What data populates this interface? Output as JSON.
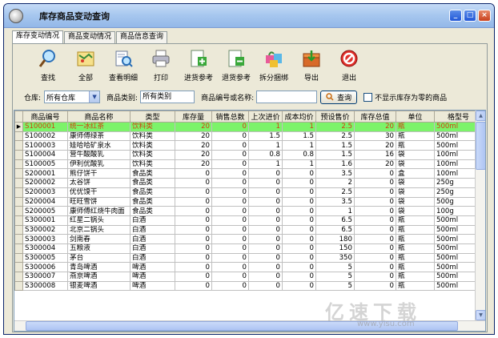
{
  "window": {
    "title": "库存商品变动查询",
    "minimize": "_",
    "maximize": "□",
    "close": "×"
  },
  "tabs": [
    "库存变动情况",
    "商品变动情况",
    "商品信息查询"
  ],
  "toolbar": [
    {
      "label": "查找",
      "icon": "magnifier-icon"
    },
    {
      "label": "全部",
      "icon": "map-icon"
    },
    {
      "label": "查看明细",
      "icon": "detail-search-icon"
    },
    {
      "label": "打印",
      "icon": "printer-icon"
    },
    {
      "label": "进货参考",
      "icon": "document-add-icon"
    },
    {
      "label": "退货参考",
      "icon": "document-remove-icon"
    },
    {
      "label": "拆分捆绑",
      "icon": "package-icon"
    },
    {
      "label": "导出",
      "icon": "export-box-icon"
    },
    {
      "label": "退出",
      "icon": "exit-icon"
    }
  ],
  "filter": {
    "warehouse_label": "仓库:",
    "warehouse_value": "所有仓库",
    "category_label": "商品类别:",
    "category_value": "所有类别",
    "code_label": "商品编号或名称:",
    "code_value": "",
    "query_label": "查询",
    "zero_stock_label": "不显示库存为零的商品"
  },
  "table": {
    "columns": [
      "商品编号",
      "商品名称",
      "类型",
      "库存量",
      "销售总数",
      "上次进价",
      "成本均价",
      "预设售价",
      "库存总值",
      "单位",
      "格型号"
    ],
    "rows": [
      [
        "S100001",
        "统一冰红茶",
        "饮料类",
        "20",
        "0",
        "1",
        "1",
        "2.5",
        "20",
        "瓶",
        "500ml"
      ],
      [
        "S100002",
        "康师傅绿茶",
        "饮料类",
        "20",
        "0",
        "1.5",
        "1.5",
        "2.5",
        "30",
        "瓶",
        "500ml"
      ],
      [
        "S100003",
        "娃哈哈矿泉水",
        "饮料类",
        "20",
        "0",
        "1",
        "1",
        "1.5",
        "20",
        "瓶",
        "500ml"
      ],
      [
        "S100004",
        "营牛酸酸乳",
        "饮料类",
        "20",
        "0",
        "0.8",
        "0.8",
        "1.5",
        "16",
        "袋",
        "100ml"
      ],
      [
        "S100005",
        "伊利优酸乳",
        "饮料类",
        "20",
        "0",
        "1",
        "1",
        "1.6",
        "20",
        "袋",
        "100ml"
      ],
      [
        "S200001",
        "熊仔饼干",
        "食品类",
        "0",
        "0",
        "0",
        "0",
        "3.5",
        "0",
        "盒",
        "100ml"
      ],
      [
        "S200002",
        "太谷饼",
        "食品类",
        "0",
        "0",
        "0",
        "0",
        "2",
        "0",
        "袋",
        "250g"
      ],
      [
        "S200003",
        "优优馍干",
        "食品类",
        "0",
        "0",
        "0",
        "0",
        "2.5",
        "0",
        "袋",
        "250g"
      ],
      [
        "S200004",
        "旺旺雪饼",
        "食品类",
        "0",
        "0",
        "0",
        "0",
        "3.5",
        "0",
        "袋",
        "500g"
      ],
      [
        "S200005",
        "康师傅红烧牛肉面",
        "食品类",
        "0",
        "0",
        "0",
        "0",
        "1",
        "0",
        "袋",
        "100g"
      ],
      [
        "S300001",
        "红星二锅头",
        "白酒",
        "0",
        "0",
        "0",
        "0",
        "6.5",
        "0",
        "瓶",
        "500ml"
      ],
      [
        "S300002",
        "北京二锅头",
        "白酒",
        "0",
        "0",
        "0",
        "0",
        "6.5",
        "0",
        "瓶",
        "500ml"
      ],
      [
        "S300003",
        "剑南春",
        "白酒",
        "0",
        "0",
        "0",
        "0",
        "180",
        "0",
        "瓶",
        "500ml"
      ],
      [
        "S300004",
        "五粮液",
        "白酒",
        "0",
        "0",
        "0",
        "0",
        "150",
        "0",
        "瓶",
        "500ml"
      ],
      [
        "S300005",
        "茅台",
        "白酒",
        "0",
        "0",
        "0",
        "0",
        "350",
        "0",
        "瓶",
        "500ml"
      ],
      [
        "S300006",
        "青岛啤酒",
        "啤酒",
        "0",
        "0",
        "0",
        "0",
        "5",
        "0",
        "瓶",
        "500ml"
      ],
      [
        "S300007",
        "燕京啤酒",
        "啤酒",
        "0",
        "0",
        "0",
        "0",
        "5",
        "0",
        "瓶",
        "500ml"
      ],
      [
        "S300008",
        "银麦啤酒",
        "啤酒",
        "0",
        "0",
        "0",
        "0",
        "5",
        "0",
        "瓶",
        "500ml"
      ]
    ]
  },
  "watermark": {
    "text": "亿速下载",
    "url": "www.yisu.com"
  },
  "colors": {
    "selected_row_bg": "#7cf36a",
    "selected_row_text": "#d04010",
    "titlebar": "#a8c8ef"
  }
}
